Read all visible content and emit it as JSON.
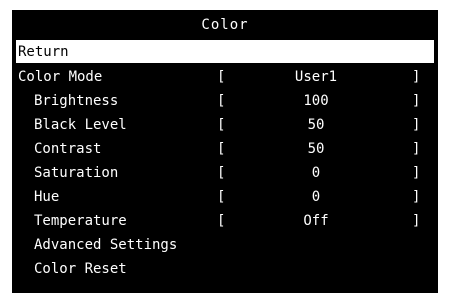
{
  "menu": {
    "title": "Color",
    "items": [
      {
        "label": "Return",
        "selected": true,
        "indent": false,
        "value": null
      },
      {
        "label": "Color Mode",
        "selected": false,
        "indent": false,
        "value": "User1"
      },
      {
        "label": "Brightness",
        "selected": false,
        "indent": true,
        "value": "100"
      },
      {
        "label": "Black Level",
        "selected": false,
        "indent": true,
        "value": "50"
      },
      {
        "label": "Contrast",
        "selected": false,
        "indent": true,
        "value": "50"
      },
      {
        "label": "Saturation",
        "selected": false,
        "indent": true,
        "value": "0"
      },
      {
        "label": "Hue",
        "selected": false,
        "indent": true,
        "value": "0"
      },
      {
        "label": "Temperature",
        "selected": false,
        "indent": true,
        "value": "Off"
      },
      {
        "label": "Advanced Settings",
        "selected": false,
        "indent": true,
        "value": null
      },
      {
        "label": "Color Reset",
        "selected": false,
        "indent": true,
        "value": null
      }
    ],
    "bracket_open": "[",
    "bracket_close": "]"
  },
  "colors": {
    "background": "#000000",
    "text": "#ffffff",
    "selected_background": "#ffffff",
    "selected_text": "#000000"
  }
}
